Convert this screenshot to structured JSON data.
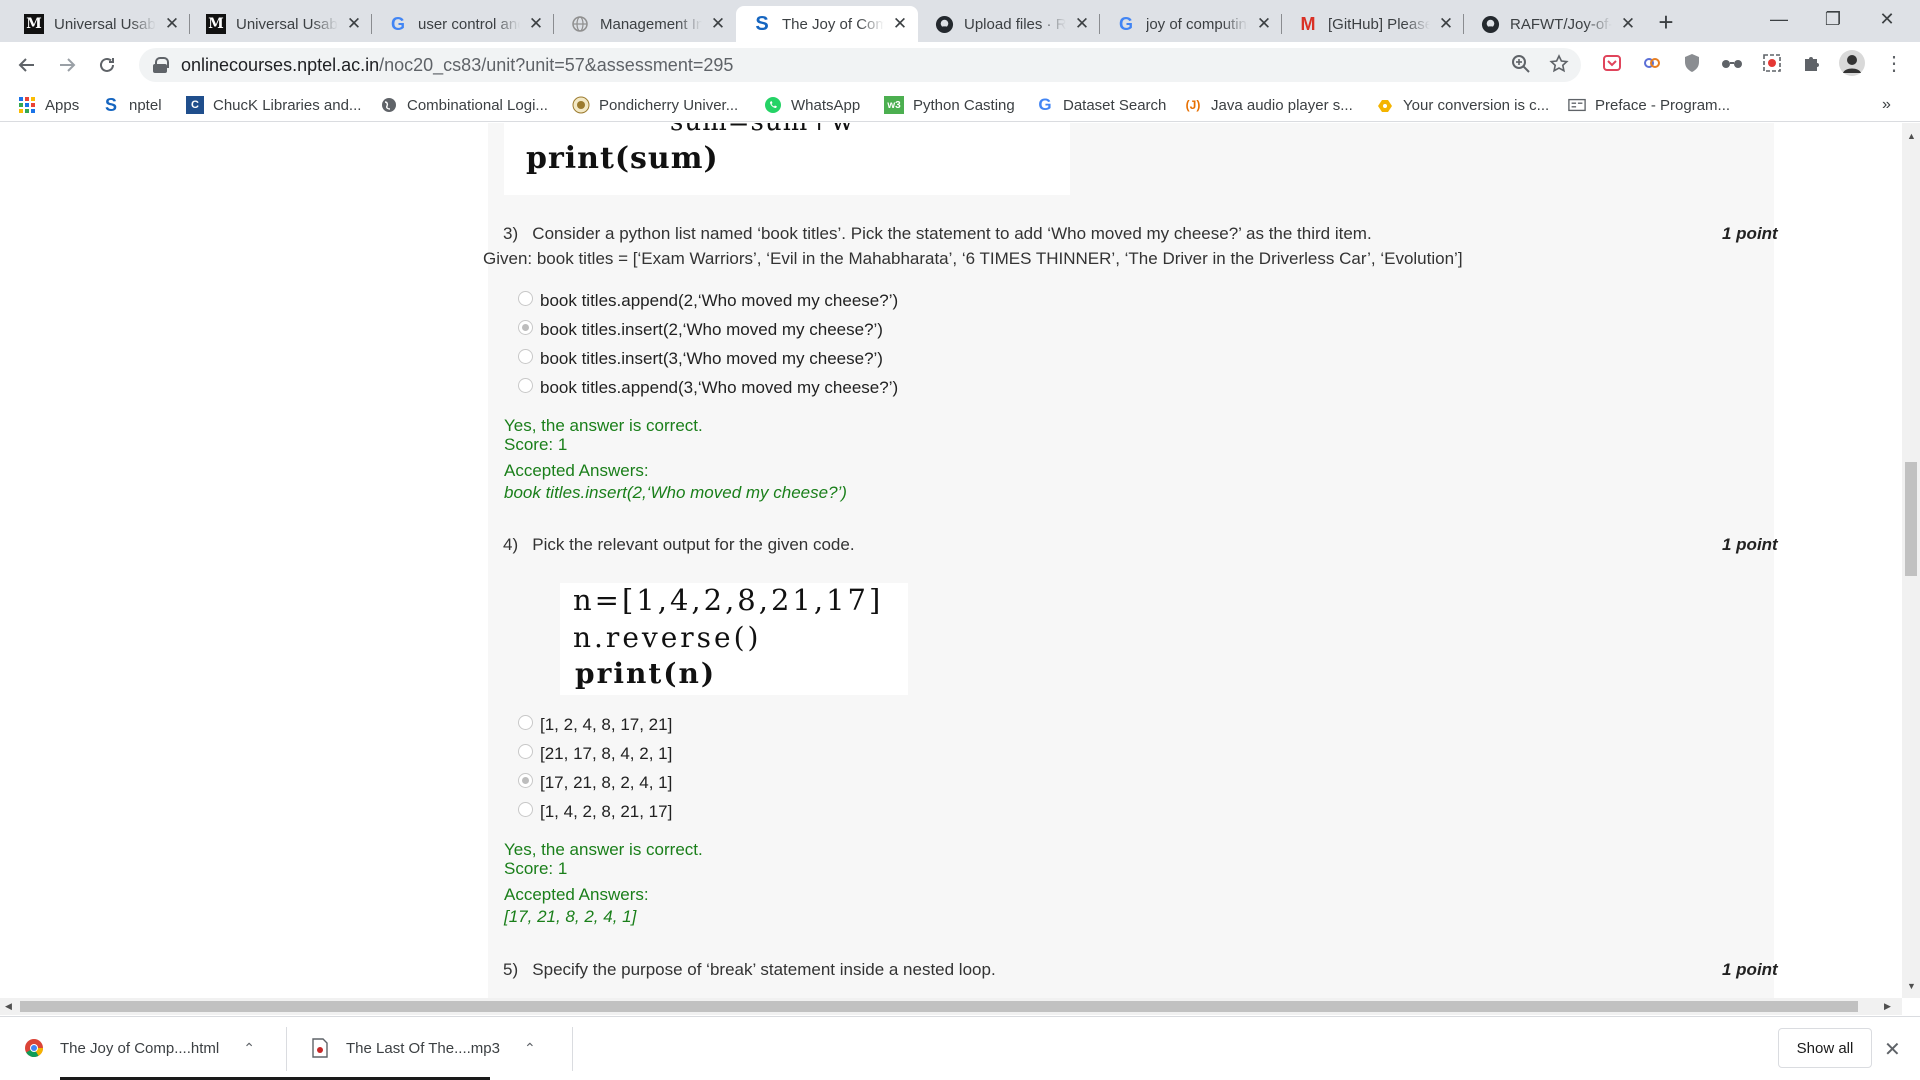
{
  "tabs": [
    {
      "title": "Universal Usability",
      "favicon": "M",
      "active": false
    },
    {
      "title": "Universal Usability",
      "favicon": "M",
      "active": false
    },
    {
      "title": "user control and freedom",
      "favicon": "G",
      "active": false
    },
    {
      "title": "Management Info",
      "favicon": "globe",
      "active": false
    },
    {
      "title": "The Joy of Computing",
      "favicon": "S",
      "active": true
    },
    {
      "title": "Upload files · RAFWT",
      "favicon": "github",
      "active": false
    },
    {
      "title": "joy of computing",
      "favicon": "G",
      "active": false
    },
    {
      "title": "[GitHub] Please verify",
      "favicon": "M",
      "active": false
    },
    {
      "title": "RAFWT/Joy-of-Computing",
      "favicon": "github",
      "active": false
    }
  ],
  "tab_close_glyph": "✕",
  "new_tab_glyph": "+",
  "window_controls": {
    "minimize": "—",
    "restore": "❐",
    "close": "✕"
  },
  "address": {
    "host": "onlinecourses.nptel.ac.in",
    "path": "/noc20_cs83/unit?unit=57&assessment=295"
  },
  "bookmarks": [
    {
      "label": "Apps",
      "icon": "apps-grid-icon"
    },
    {
      "label": "nptel",
      "icon": "nptel-icon"
    },
    {
      "label": "ChucK Libraries and...",
      "icon": "chuck-icon"
    },
    {
      "label": "Combinational Logi...",
      "icon": "globe-icon"
    },
    {
      "label": "Pondicherry Univer...",
      "icon": "university-icon"
    },
    {
      "label": "WhatsApp",
      "icon": "whatsapp-icon"
    },
    {
      "label": "Python Casting",
      "icon": "w3-icon"
    },
    {
      "label": "Dataset Search",
      "icon": "google-icon"
    },
    {
      "label": "Java audio player s...",
      "icon": "java-icon"
    },
    {
      "label": "Your conversion is c...",
      "icon": "converter-icon"
    },
    {
      "label": "Preface - Program...",
      "icon": "book-icon"
    }
  ],
  "bookmarks_overflow": "»",
  "page": {
    "code_top": {
      "line_partial": "sum=sum+w",
      "line": "print(sum)"
    },
    "q3": {
      "number": "3)",
      "text": "Consider a python list named ‘book titles’. Pick the statement to add ‘Who moved my cheese?’ as the third item.",
      "given": "Given: book titles = [‘Exam Warriors’, ‘Evil in the Mahabharata’, ‘6 TIMES THINNER’, ‘The Driver in the Driverless Car’, ‘Evolution’]",
      "points": "1 point",
      "options": [
        {
          "text": "book titles.append(2,‘Who moved my cheese?’)",
          "selected": false
        },
        {
          "text": "book titles.insert(2,‘Who moved my cheese?’)",
          "selected": true
        },
        {
          "text": "book titles.insert(3,‘Who moved my cheese?’)",
          "selected": false
        },
        {
          "text": "book titles.append(3,‘Who moved my cheese?’)",
          "selected": false
        }
      ],
      "feedback": "Yes, the answer is correct.",
      "score": "Score: 1",
      "accepted_label": "Accepted Answers:",
      "accepted": "book titles.insert(2,‘Who moved my cheese?’)"
    },
    "q4": {
      "number": "4)",
      "text": "Pick the relevant output for the given code.",
      "points": "1 point",
      "code": [
        "n=[1,4,2,8,21,17]",
        "n.reverse()",
        "print(n)"
      ],
      "options": [
        {
          "text": "[1, 2, 4, 8, 17, 21]",
          "selected": false
        },
        {
          "text": "[21, 17, 8, 4, 2, 1]",
          "selected": false
        },
        {
          "text": "[17, 21, 8, 2, 4, 1]",
          "selected": true
        },
        {
          "text": "[1, 4, 2, 8, 21, 17]",
          "selected": false
        }
      ],
      "feedback": "Yes, the answer is correct.",
      "score": "Score: 1",
      "accepted_label": "Accepted Answers:",
      "accepted": "[17, 21, 8, 2, 4, 1]"
    },
    "q5": {
      "number": "5)",
      "text": "Specify the purpose of ‘break’ statement inside a nested loop.",
      "points": "1 point"
    }
  },
  "downloads": [
    {
      "name": "The Joy of Comp....html",
      "icon": "chrome-icon"
    },
    {
      "name": "The Last Of The....mp3",
      "icon": "audio-file-icon"
    }
  ],
  "show_all_label": "Show all",
  "colors": {
    "correct": "#1a7f1a",
    "panel": "#f7f7f7",
    "tabstrip": "#dee1e6"
  }
}
